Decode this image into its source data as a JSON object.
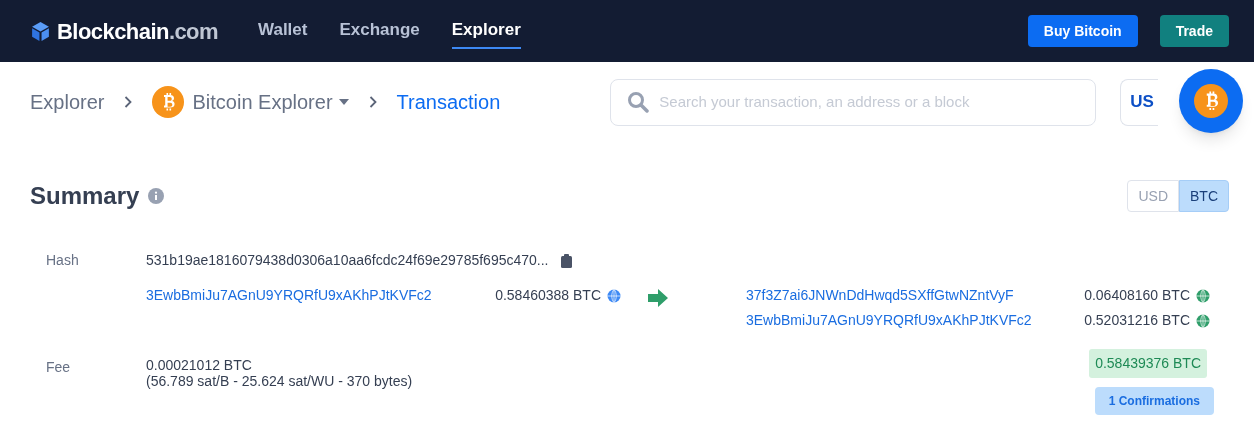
{
  "header": {
    "logo": {
      "name": "Blockchain",
      "suffix": ".com"
    },
    "nav": [
      {
        "label": "Wallet",
        "selected": false
      },
      {
        "label": "Exchange",
        "selected": false
      },
      {
        "label": "Explorer",
        "selected": true
      }
    ],
    "buttons": [
      {
        "label": "Buy Bitcoin",
        "kind": "primary"
      },
      {
        "label": "Trade",
        "kind": "secondary"
      }
    ]
  },
  "breadcrumb": [
    {
      "label": "Explorer",
      "kind": "link"
    },
    {
      "label": "Bitcoin Explorer",
      "kind": "dropdown"
    },
    {
      "label": "Transaction",
      "kind": "current"
    }
  ],
  "search": {
    "placeholder": "Search your transaction, an address or a block"
  },
  "currency_button": {
    "label": "US"
  },
  "summary": {
    "title": "Summary",
    "currency_toggle": [
      {
        "label": "USD",
        "selected": false
      },
      {
        "label": "BTC",
        "selected": true
      }
    ],
    "hash": {
      "label": "Hash",
      "value": "531b19ae1816079438d0306a10aa6fcdc24f69e29785f695c470..."
    },
    "inputs": [
      {
        "address": "3EwbBmiJu7AGnU9YRQRfU9xAKhPJtKVFc2",
        "amount": "0.58460388 BTC",
        "color": "#3d89f5"
      }
    ],
    "outputs": [
      {
        "address": "37f3Z7ai6JNWnDdHwqd5SXffGtwNZntVyF",
        "amount": "0.06408160 BTC",
        "color": "#2f9e6a"
      },
      {
        "address": "3EwbBmiJu7AGnU9YRQRfU9xAKhPJtKVFc2",
        "amount": "0.52031216 BTC",
        "color": "#2f9e6a"
      }
    ],
    "fee": {
      "label": "Fee",
      "amount": "0.00021012 BTC",
      "detail": "(56.789 sat/B - 25.624 sat/WU - 370 bytes)"
    },
    "total": "0.58439376 BTC",
    "confirmations": "1 Confirmations"
  }
}
